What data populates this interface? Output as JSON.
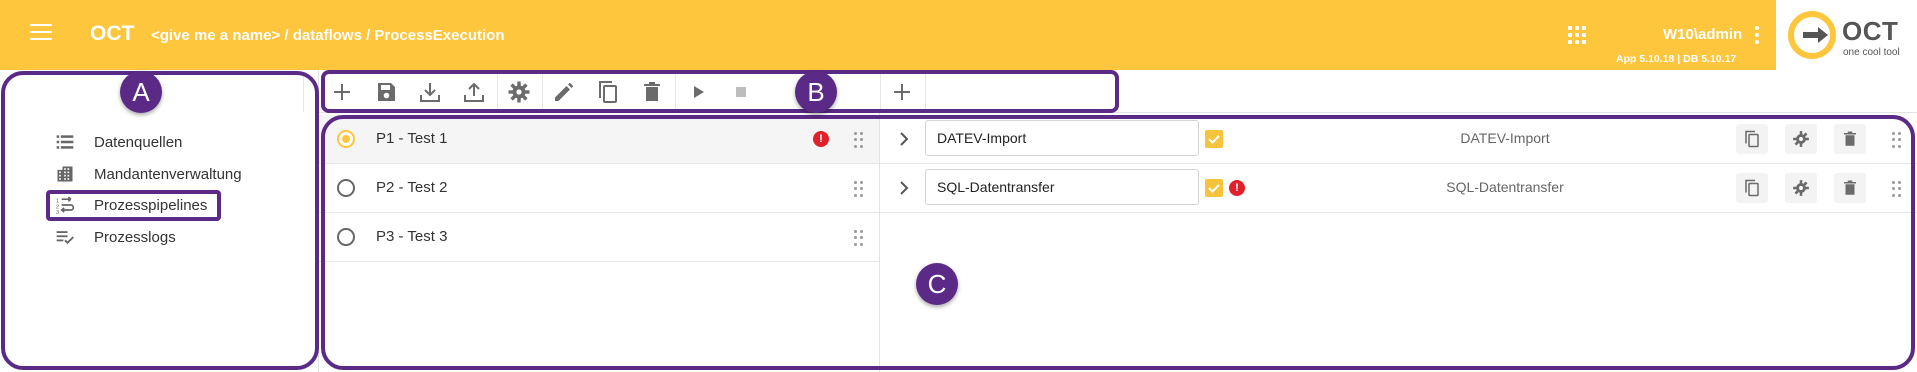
{
  "header": {
    "app_title": "OCT",
    "breadcrumb": "<give me a name> / dataflows / ProcessExecution",
    "user": "W10\\admin",
    "version": "App 5.10.18 | DB 5.10.17",
    "logo_text": "OCT",
    "logo_subtext": "one cool tool",
    "background_color": "#fdc63c"
  },
  "sidebar": {
    "items": [
      {
        "label": "Datenquellen",
        "icon": "list-icon"
      },
      {
        "label": "Mandantenverwaltung",
        "icon": "building-icon"
      },
      {
        "label": "Prozesspipelines",
        "icon": "pipeline-icon",
        "active": true
      },
      {
        "label": "Prozesslogs",
        "icon": "log-check-icon"
      }
    ]
  },
  "toolbar": {
    "buttons": [
      "add-icon",
      "save-icon",
      "download-icon",
      "upload-icon",
      "settings-icon",
      "edit-icon",
      "copy-icon",
      "delete-icon",
      "play-icon",
      "stop-icon"
    ],
    "add_step_button": "add-icon"
  },
  "pipelines": [
    {
      "name": "P1 - Test 1",
      "selected": true,
      "error": true
    },
    {
      "name": "P2 - Test 2",
      "selected": false,
      "error": false
    },
    {
      "name": "P3 - Test 3",
      "selected": false,
      "error": false
    }
  ],
  "steps": [
    {
      "name": "DATEV-Import",
      "type": "DATEV-Import",
      "checked": true,
      "error": false
    },
    {
      "name": "SQL-Datentransfer",
      "type": "SQL-Datentransfer",
      "checked": true,
      "error": true
    }
  ],
  "error_badge_text": "!",
  "annotations": [
    {
      "label": "A"
    },
    {
      "label": "B"
    },
    {
      "label": "C"
    }
  ],
  "colors": {
    "accent": "#fdc63c",
    "annotation": "#5b2a86",
    "error": "#e0202a"
  }
}
